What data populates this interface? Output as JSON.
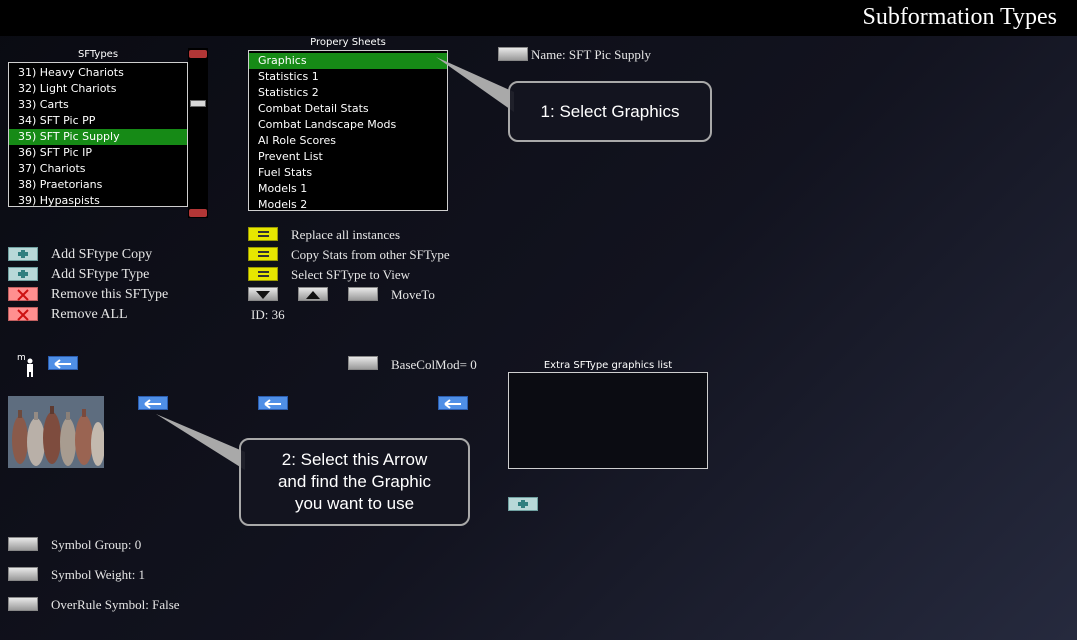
{
  "title": "Subformation Types",
  "sftypes": {
    "caption": "SFTypes",
    "items": [
      "31) Heavy Chariots",
      "32) Light Chariots",
      "33) Carts",
      "34) SFT Pic PP",
      "35) SFT Pic Supply",
      "36) SFT Pic IP",
      "37) Chariots",
      "38) Praetorians",
      "39) Hypaspists"
    ],
    "selected_index": 4
  },
  "property_sheets": {
    "caption": "Propery Sheets",
    "items": [
      "Graphics",
      "Statistics 1",
      "Statistics 2",
      "Combat Detail Stats",
      "Combat Landscape Mods",
      "AI Role Scores",
      "Prevent List",
      "Fuel Stats",
      "Models 1",
      "Models 2"
    ],
    "selected_index": 0
  },
  "name_label": "Name: SFT Pic Supply",
  "actions": {
    "replace_all": "Replace all instances",
    "copy_stats": "Copy Stats from other SFType",
    "select_view": "Select SFType to View",
    "move_to": "MoveTo",
    "id_label": "ID:  36",
    "add_copy": "Add SFtype Copy",
    "add_type": "Add SFtype Type",
    "remove_this": "Remove this SFType",
    "remove_all": "Remove ALL"
  },
  "graphics": {
    "base_col_mod": "BaseColMod= 0",
    "extra_list_caption": "Extra SFType graphics list",
    "symbol_group": "Symbol Group:  0",
    "symbol_weight": "Symbol Weight:  1",
    "overrule_symbol": "OverRule Symbol: False",
    "small_icon_letter": "m"
  },
  "callouts": {
    "one": "1: Select Graphics",
    "two_lines": [
      "2: Select this Arrow",
      "and find the Graphic",
      "you want to use"
    ]
  },
  "colors": {
    "selection_green": "#168a16",
    "yellow_button": "#e6e600",
    "blue_arrow": "#4f8fe6",
    "remove_red": "#ff8f8f",
    "add_teal": "#b8d8d8"
  }
}
